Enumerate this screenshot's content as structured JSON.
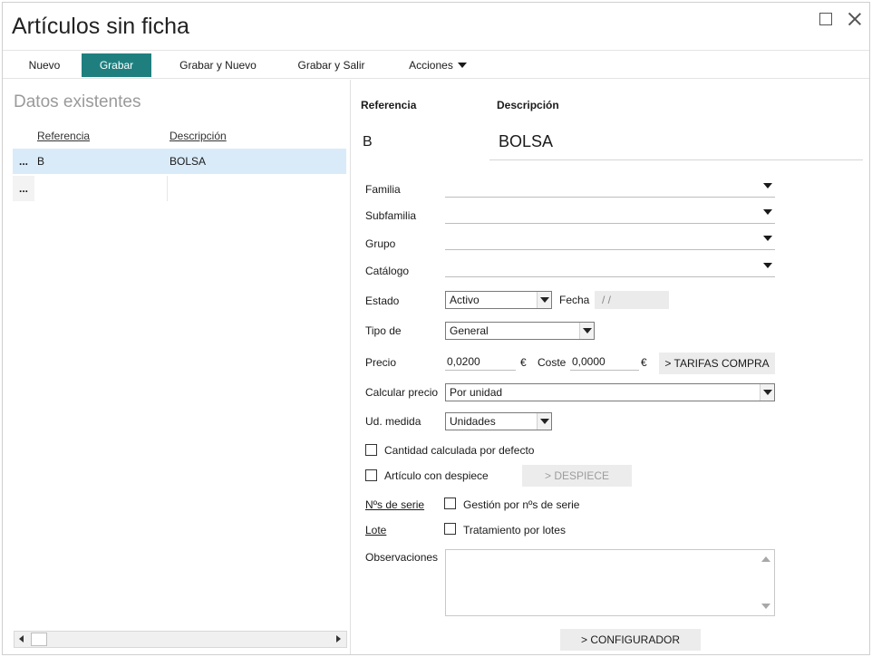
{
  "window": {
    "title": "Artículos sin ficha"
  },
  "toolbar": {
    "nuevo": "Nuevo",
    "grabar": "Grabar",
    "grabar_nuevo": "Grabar y Nuevo",
    "grabar_salir": "Grabar y Salir",
    "acciones": "Acciones"
  },
  "existing": {
    "title": "Datos existentes",
    "col_ref": "Referencia",
    "col_desc": "Descripción",
    "rows": [
      {
        "dots": "...",
        "ref": "B",
        "desc": "BOLSA"
      },
      {
        "dots": "...",
        "ref": "",
        "desc": ""
      }
    ]
  },
  "form": {
    "ref_label": "Referencia",
    "desc_label": "Descripción",
    "ref_value": "B",
    "desc_value": "BOLSA",
    "familia_label": "Familia",
    "subfamilia_label": "Subfamilia",
    "grupo_label": "Grupo",
    "catalogo_label": "Catálogo",
    "estado_label": "Estado",
    "estado_value": "Activo",
    "fecha_label": "Fecha",
    "fecha_value": "/ /",
    "tipo_label": "Tipo de",
    "tipo_value": "General",
    "precio_label": "Precio",
    "precio_value": "0,0200",
    "currency": "€",
    "coste_label": "Coste",
    "coste_value": "0,0000",
    "tarifas_button": "> TARIFAS COMPRA",
    "calcular_label": "Calcular precio",
    "calcular_value": "Por unidad",
    "udmedida_label": "Ud. medida",
    "udmedida_value": "Unidades",
    "cantidad_check": "Cantidad calculada por defecto",
    "despiece_check": "Artículo con despiece",
    "despiece_button": "> DESPIECE",
    "nserie_link": "Nºs de serie",
    "nserie_check": "Gestión por nºs de serie",
    "lote_link": "Lote",
    "lote_check": "Tratamiento por lotes",
    "observaciones_label": "Observaciones",
    "configurador_button": "> CONFIGURADOR"
  },
  "colors": {
    "accent": "#1f7f7f",
    "selection": "#d9ebf9"
  }
}
